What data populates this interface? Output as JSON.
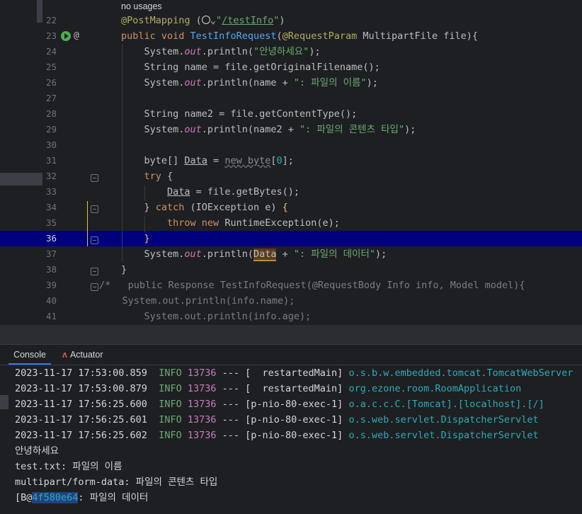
{
  "editor": {
    "usage_hint": "no usages",
    "lines": [
      {
        "n": "22",
        "segments": [
          [
            "ann",
            "@PostMapping"
          ],
          [
            "txt",
            " ("
          ],
          [
            "globe",
            ""
          ],
          [
            "txt",
            "⌄"
          ],
          [
            "str",
            "\""
          ],
          [
            "link",
            "/testInfo"
          ],
          [
            "str",
            "\""
          ],
          [
            "txt",
            ")"
          ]
        ]
      },
      {
        "n": "23",
        "segments": [
          [
            "kw",
            "public void "
          ],
          [
            "fn",
            "TestInfoRequest"
          ],
          [
            "txt",
            "("
          ],
          [
            "ann",
            "@RequestParam"
          ],
          [
            "txt",
            " MultipartFile file){"
          ]
        ]
      },
      {
        "n": "24",
        "segments": [
          [
            "txt",
            "    System."
          ],
          [
            "field",
            "out"
          ],
          [
            "txt",
            ".println("
          ],
          [
            "str",
            "\"안녕하세요\""
          ],
          [
            "txt",
            ");"
          ]
        ]
      },
      {
        "n": "25",
        "segments": [
          [
            "txt",
            "    String name = file.getOriginalFilename();"
          ]
        ]
      },
      {
        "n": "26",
        "segments": [
          [
            "txt",
            "    System."
          ],
          [
            "field",
            "out"
          ],
          [
            "txt",
            ".println(name + "
          ],
          [
            "str",
            "\": 파일의 이름\""
          ],
          [
            "txt",
            ");"
          ]
        ]
      },
      {
        "n": "27",
        "segments": []
      },
      {
        "n": "28",
        "segments": [
          [
            "txt",
            "    String name2 = file.getContentType();"
          ]
        ]
      },
      {
        "n": "29",
        "segments": [
          [
            "txt",
            "    System."
          ],
          [
            "field",
            "out"
          ],
          [
            "txt",
            ".println(name2 + "
          ],
          [
            "str",
            "\": 파일의 콘텐츠 타입\""
          ],
          [
            "txt",
            ");"
          ]
        ]
      },
      {
        "n": "30",
        "segments": []
      },
      {
        "n": "31",
        "segments": [
          [
            "txt",
            "    byte[] "
          ],
          [
            "ul",
            "Data"
          ],
          [
            "txt",
            " = "
          ],
          [
            "ghost",
            "new byte"
          ],
          [
            "txt",
            "["
          ],
          [
            "num",
            "0"
          ],
          [
            "txt",
            "];"
          ]
        ]
      },
      {
        "n": "32",
        "segments": [
          [
            "kw",
            "    try"
          ],
          [
            "txt",
            " {"
          ]
        ]
      },
      {
        "n": "33",
        "segments": [
          [
            "txt",
            "        "
          ],
          [
            "ul",
            "Data"
          ],
          [
            "txt",
            " = file.getBytes();"
          ]
        ]
      },
      {
        "n": "34",
        "segments": [
          [
            "txt",
            "    } "
          ],
          [
            "kw",
            "catch"
          ],
          [
            "txt",
            " (IOException e) "
          ],
          [
            "brace",
            "{"
          ]
        ]
      },
      {
        "n": "35",
        "segments": [
          [
            "txt",
            "        "
          ],
          [
            "kw",
            "throw new"
          ],
          [
            "txt",
            " RuntimeException(e);"
          ]
        ]
      },
      {
        "n": "36",
        "segments": [
          [
            "txt",
            "    "
          ],
          [
            "brace",
            "}"
          ]
        ]
      },
      {
        "n": "37",
        "segments": [
          [
            "txt",
            "    System."
          ],
          [
            "field",
            "out"
          ],
          [
            "txt",
            ".println("
          ],
          [
            "hl",
            "Data"
          ],
          [
            "txt",
            " + "
          ],
          [
            "str",
            "\": 파일의 데이터\""
          ],
          [
            "txt",
            ");"
          ]
        ]
      },
      {
        "n": "38",
        "segments": [
          [
            "txt",
            "}"
          ]
        ]
      },
      {
        "n": "39",
        "segments": [
          [
            "cmt",
            "/*"
          ],
          [
            "txt",
            "   "
          ],
          [
            "cmt",
            "public Response TestInfoRequest(@RequestBody Info info, Model model){"
          ]
        ]
      },
      {
        "n": "40",
        "segments": [
          [
            "cmt",
            "    System.out.println(info.name);"
          ]
        ]
      },
      {
        "n": "41",
        "segments": [
          [
            "cmt",
            "    System.out.println(info.age);"
          ]
        ]
      }
    ],
    "current_line": "36"
  },
  "panel": {
    "tabs": [
      {
        "label": "Console",
        "active": true
      },
      {
        "label": "Actuator",
        "active": false
      }
    ]
  },
  "console": {
    "log_rows": [
      {
        "ts": "2023-11-17 17:53:00.859",
        "level": "INFO",
        "pid": "13736",
        "sep": "---",
        "thread": "[  restartedMain]",
        "logger": "o.s.b.w.embedded.tomcat.TomcatWebServer  :"
      },
      {
        "ts": "2023-11-17 17:53:00.879",
        "level": "INFO",
        "pid": "13736",
        "sep": "---",
        "thread": "[  restartedMain]",
        "logger": "org.ezone.room.RoomApplication           :"
      },
      {
        "ts": "2023-11-17 17:56:25.600",
        "level": "INFO",
        "pid": "13736",
        "sep": "---",
        "thread": "[p-nio-80-exec-1]",
        "logger": "o.a.c.c.C.[Tomcat].[localhost].[/]       :"
      },
      {
        "ts": "2023-11-17 17:56:25.601",
        "level": "INFO",
        "pid": "13736",
        "sep": "---",
        "thread": "[p-nio-80-exec-1]",
        "logger": "o.s.web.servlet.DispatcherServlet        :"
      },
      {
        "ts": "2023-11-17 17:56:25.602",
        "level": "INFO",
        "pid": "13736",
        "sep": "---",
        "thread": "[p-nio-80-exec-1]",
        "logger": "o.s.web.servlet.DispatcherServlet        :"
      }
    ],
    "output_lines": [
      "안녕하세요",
      "test.txt: 파일의 이름",
      "multipart/form-data: 파일의 콘텐츠 타입"
    ],
    "last_line": {
      "prefix": "[B@",
      "selected": "4f580e64",
      "suffix": ": 파일의 데이터"
    }
  },
  "colors": {
    "current_line": "#00007f",
    "accent": "#3574f0"
  }
}
